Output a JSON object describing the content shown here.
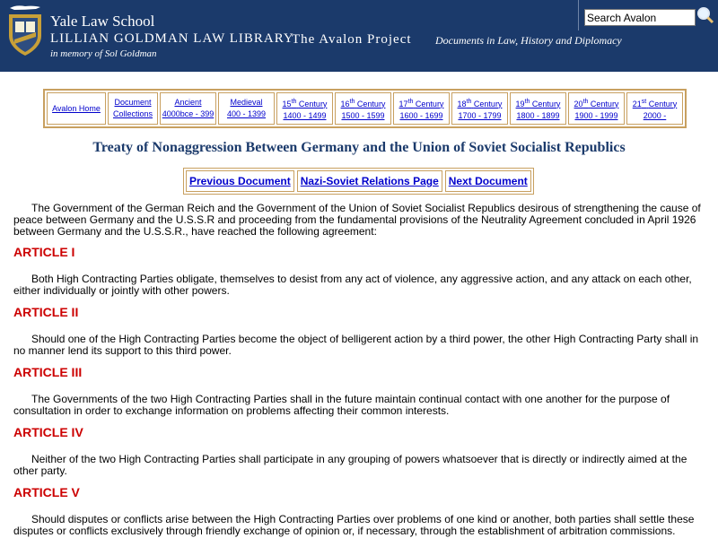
{
  "header": {
    "school": "Yale Law School",
    "library": "Lillian Goldman Law Library",
    "memory": "in memory of Sol Goldman",
    "project": "The Avalon Project",
    "project_sub": "Documents in Law, History and Diplomacy",
    "search_value": "Search Avalon",
    "colors": {
      "bg": "#1b3a6b"
    }
  },
  "nav": [
    {
      "line1": "Avalon Home",
      "line2": ""
    },
    {
      "line1": "Document",
      "line2": "Collections"
    },
    {
      "line1": "Ancient",
      "line2": "4000bce - 399"
    },
    {
      "line1": "Medieval",
      "line2": "400 - 1399"
    },
    {
      "num": "15",
      "sup": "th",
      "word": "Century",
      "line2": "1400 - 1499"
    },
    {
      "num": "16",
      "sup": "th",
      "word": "Century",
      "line2": "1500 - 1599"
    },
    {
      "num": "17",
      "sup": "th",
      "word": "Century",
      "line2": "1600 - 1699"
    },
    {
      "num": "18",
      "sup": "th",
      "word": "Century",
      "line2": "1700 - 1799"
    },
    {
      "num": "19",
      "sup": "th",
      "word": "Century",
      "line2": "1800 - 1899"
    },
    {
      "num": "20",
      "sup": "th",
      "word": "Century",
      "line2": "1900 - 1999"
    },
    {
      "num": "21",
      "sup": "st",
      "word": "Century",
      "line2": "2000 -"
    }
  ],
  "title": "Treaty of Nonaggression Between Germany and the Union of Soviet Socialist Republics",
  "docnav": {
    "prev": "Previous Document",
    "middle": "Nazi-Soviet Relations Page",
    "next": "Next Document"
  },
  "intro": "The Government of the German Reich and the Government of the Union of Soviet Socialist Republics desirous of strengthening the cause of peace between Germany and the U.S.S.R and proceeding from the fundamental provisions of the Neutrality Agreement concluded in April 1926 between Germany and the U.S.S.R., have reached the following agreement:",
  "articles": [
    {
      "heading": "ARTICLE I",
      "text": "Both High Contracting Parties obligate, themselves to desist from any act of violence, any aggressive action, and any attack on each other, either individually or jointly with other powers."
    },
    {
      "heading": "ARTICLE II",
      "text": "Should one of the High Contracting Parties become the object of belligerent action by a third power, the other High Contracting Party shall in no manner lend its support to this third power."
    },
    {
      "heading": "ARTICLE III",
      "text": "The Governments of the two High Contracting Parties shall in the future maintain continual contact with one another for the purpose of consultation in order to exchange information on problems affecting their common interests."
    },
    {
      "heading": "ARTICLE IV",
      "text": "Neither of the two High Contracting Parties shall participate in any grouping of powers whatsoever that is directly or indirectly aimed at the other party."
    },
    {
      "heading": "ARTICLE V",
      "text": "Should disputes or conflicts arise between the High Contracting Parties over problems of one kind or another, both parties shall settle these disputes or conflicts exclusively through friendly exchange of opinion or, if necessary, through the establishment of arbitration commissions."
    }
  ]
}
